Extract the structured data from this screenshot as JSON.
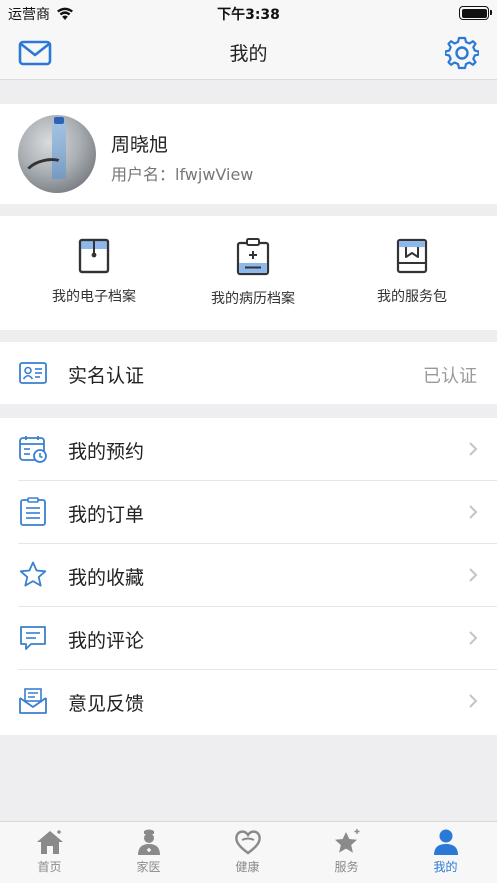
{
  "status_bar": {
    "carrier": "运营商",
    "time": "下午3:38"
  },
  "nav": {
    "title": "我的",
    "left_icon": "mail-icon",
    "right_icon": "gear-icon"
  },
  "profile": {
    "name": "周晓旭",
    "username": "用户名：lfwjwView"
  },
  "quick_actions": [
    {
      "label": "我的电子档案",
      "icon": "archive-folder-icon"
    },
    {
      "label": "我的病历档案",
      "icon": "medical-record-icon"
    },
    {
      "label": "我的服务包",
      "icon": "service-package-icon"
    }
  ],
  "verification": {
    "label": "实名认证",
    "status": "已认证",
    "icon": "id-card-icon"
  },
  "menu": [
    {
      "label": "我的预约",
      "icon": "calendar-clock-icon"
    },
    {
      "label": "我的订单",
      "icon": "order-list-icon"
    },
    {
      "label": "我的收藏",
      "icon": "star-icon"
    },
    {
      "label": "我的评论",
      "icon": "comment-icon"
    },
    {
      "label": "意见反馈",
      "icon": "feedback-envelope-icon"
    }
  ],
  "tabs": [
    {
      "label": "首页",
      "icon": "home-icon",
      "active": false
    },
    {
      "label": "家医",
      "icon": "doctor-icon",
      "active": false
    },
    {
      "label": "健康",
      "icon": "heart-icon",
      "active": false
    },
    {
      "label": "服务",
      "icon": "star-badge-icon",
      "active": false
    },
    {
      "label": "我的",
      "icon": "person-icon",
      "active": true
    }
  ],
  "colors": {
    "accent": "#2b79d7",
    "inactive_tab": "#8a8a8a",
    "background": "#eeeef0"
  }
}
